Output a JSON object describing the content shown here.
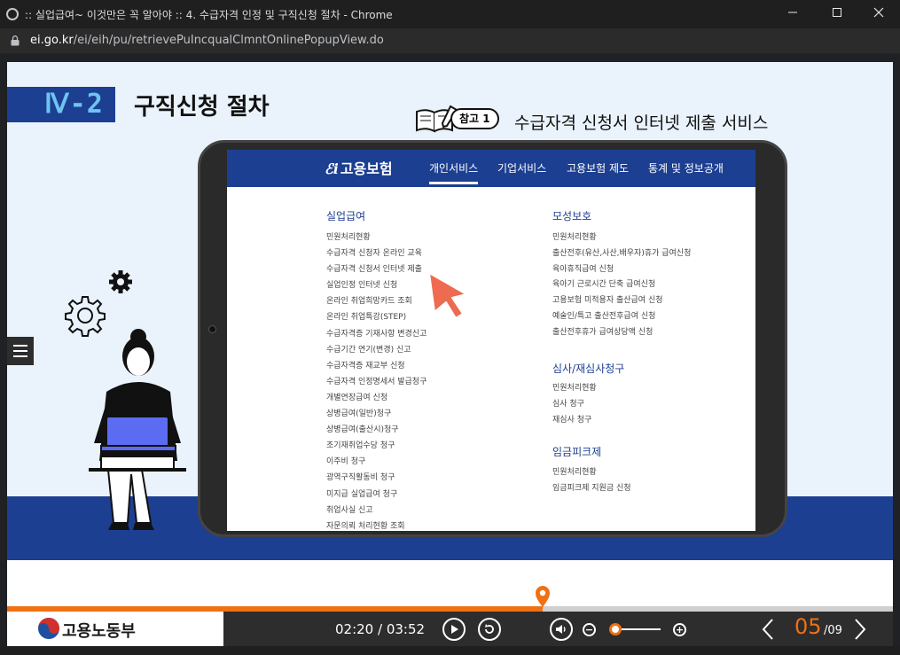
{
  "window": {
    "title": ":: 실업급여~ 이것만은 꼭 알아야 :: 4. 수급자격 인정 및 구직신청 절차 - Chrome",
    "url_host": "ei.go.kr",
    "url_path": "/ei/eih/pu/retrievePuIncqualClmntOnlinePopupView.do"
  },
  "slide": {
    "section_no": "Ⅳ-2",
    "section_title": "구직신청 절차",
    "ref_label": "참고 1",
    "ref_title": "수급자격 신청서 인터넷 제출 서비스",
    "site": {
      "logo": "고용보험",
      "nav": [
        "개인서비스",
        "기업서비스",
        "고용보험 제도",
        "통계 및 정보공개"
      ],
      "left_column": {
        "heading": "실업급여",
        "items": [
          "민원처리현황",
          "수급자격 신청자 온라인 교육",
          "수급자격 신청서 인터넷 제출",
          "실업인정 인터넷 신청",
          "온라인 취업희망카드 조회",
          "온라인 취업특강(STEP)",
          "수급자격증 기재사항 변경신고",
          "수급기간 연기(변경) 신고",
          "수급자격증 재교부 신청",
          "수급자격 인정명세서 발급청구",
          "개별연장급여 신청",
          "상병급여(일반)청구",
          "상병급여(출산시)청구",
          "조기재취업수당 청구",
          "이주비 청구",
          "광역구직활동비 청구",
          "미지급 실업급여 청구",
          "취업사실 신고",
          "자문의뢰 처리현황 조회"
        ]
      },
      "right_column": {
        "sections": [
          {
            "heading": "모성보호",
            "items": [
              "민원처리현황",
              "출산전후(유산,사산,배우자)휴가 급여신청",
              "육아휴직급여 신청",
              "육아기 근로시간 단축 급여신청",
              "고용보험 미적용자 출산급여 신청",
              "예술인/특고 출산전후급여 신청",
              "출산전후휴가 급여상당액 신청"
            ]
          },
          {
            "heading": "심사/재심사청구",
            "items": [
              "민원처리현황",
              "심사 청구",
              "재심사 청구"
            ]
          },
          {
            "heading": "임금피크제",
            "items": [
              "민원처리현황",
              "임금피크제 지원금 신청"
            ]
          }
        ]
      }
    }
  },
  "player": {
    "brand": "고용노동부",
    "time": "02:20 / 03:52",
    "progress_fraction": 0.605,
    "volume_fraction": 0.1,
    "page_current": "05",
    "page_total": "/09"
  },
  "colors": {
    "navy": "#1c3f91",
    "accent_orange": "#f07013",
    "highlight_red": "#e2554a",
    "slide_bg": "#eaf3fb"
  }
}
